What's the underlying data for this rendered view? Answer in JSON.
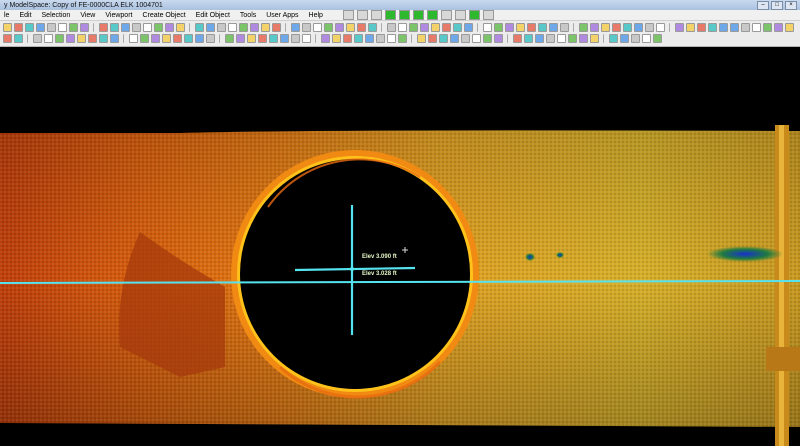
{
  "window": {
    "title": "y ModelSpace: Copy of FE-0000CLA ELK 1004701",
    "buttons": [
      "minimize",
      "maximize",
      "close"
    ]
  },
  "menu": {
    "items": [
      "le",
      "Edit",
      "Selection",
      "View",
      "Viewport",
      "Create Object",
      "Edit Object",
      "Tools",
      "User Apps",
      "Help"
    ]
  },
  "toolbar": {
    "icons": [
      "select-icon",
      "move-icon",
      "rotate-icon",
      "zoom-icon",
      "pan-icon",
      "fit-icon",
      "layer-icon",
      "color-icon",
      "measure-icon",
      "section-icon",
      "fence-icon",
      "limit-box-icon",
      "render-icon",
      "seek-icon",
      "view-icon",
      "plane-icon",
      "cylinder-icon",
      "circle-icon",
      "line-icon",
      "point-icon",
      "polyline-icon",
      "text-icon",
      "snap-icon",
      "grid-icon",
      "help-icon"
    ]
  },
  "viewport": {
    "elev_top": "Elev 3.090 ft",
    "elev_bottom": "Elev 3.028 ft",
    "colors": {
      "background": "#000000",
      "crosshair": "#56e3f0",
      "ring": "#ffb300",
      "cloud_left": "#d65a10",
      "cloud_right": "#d8a020"
    }
  }
}
